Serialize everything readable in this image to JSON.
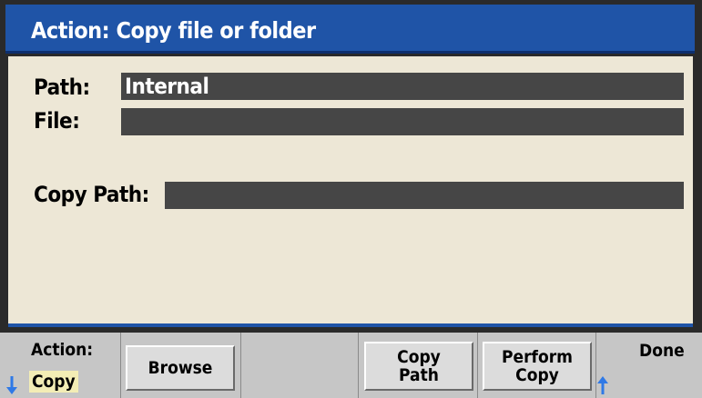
{
  "title": "Action: Copy file or folder",
  "fields": {
    "path_label": "Path:",
    "path_value": "Internal",
    "file_label": "File:",
    "file_value": "",
    "copy_path_label": "Copy Path:",
    "copy_path_value": ""
  },
  "softkeys": {
    "action_label": "Action:",
    "action_value": "Copy",
    "browse_label": "Browse",
    "copy_path_line1": "Copy",
    "copy_path_line2": "Path",
    "perform_copy_line1": "Perform",
    "perform_copy_line2": "Copy",
    "done_label": "Done"
  },
  "icons": {
    "action_arrow": "arrow-down-icon",
    "done_arrow": "arrow-up-icon"
  },
  "colors": {
    "title_bar": "#1f54a7",
    "panel_background": "#ede7d6",
    "field_background": "#464646",
    "softkey_bar": "#c6c6c6",
    "selected_value": "#f3edb5",
    "arrow": "#2f79e6"
  }
}
